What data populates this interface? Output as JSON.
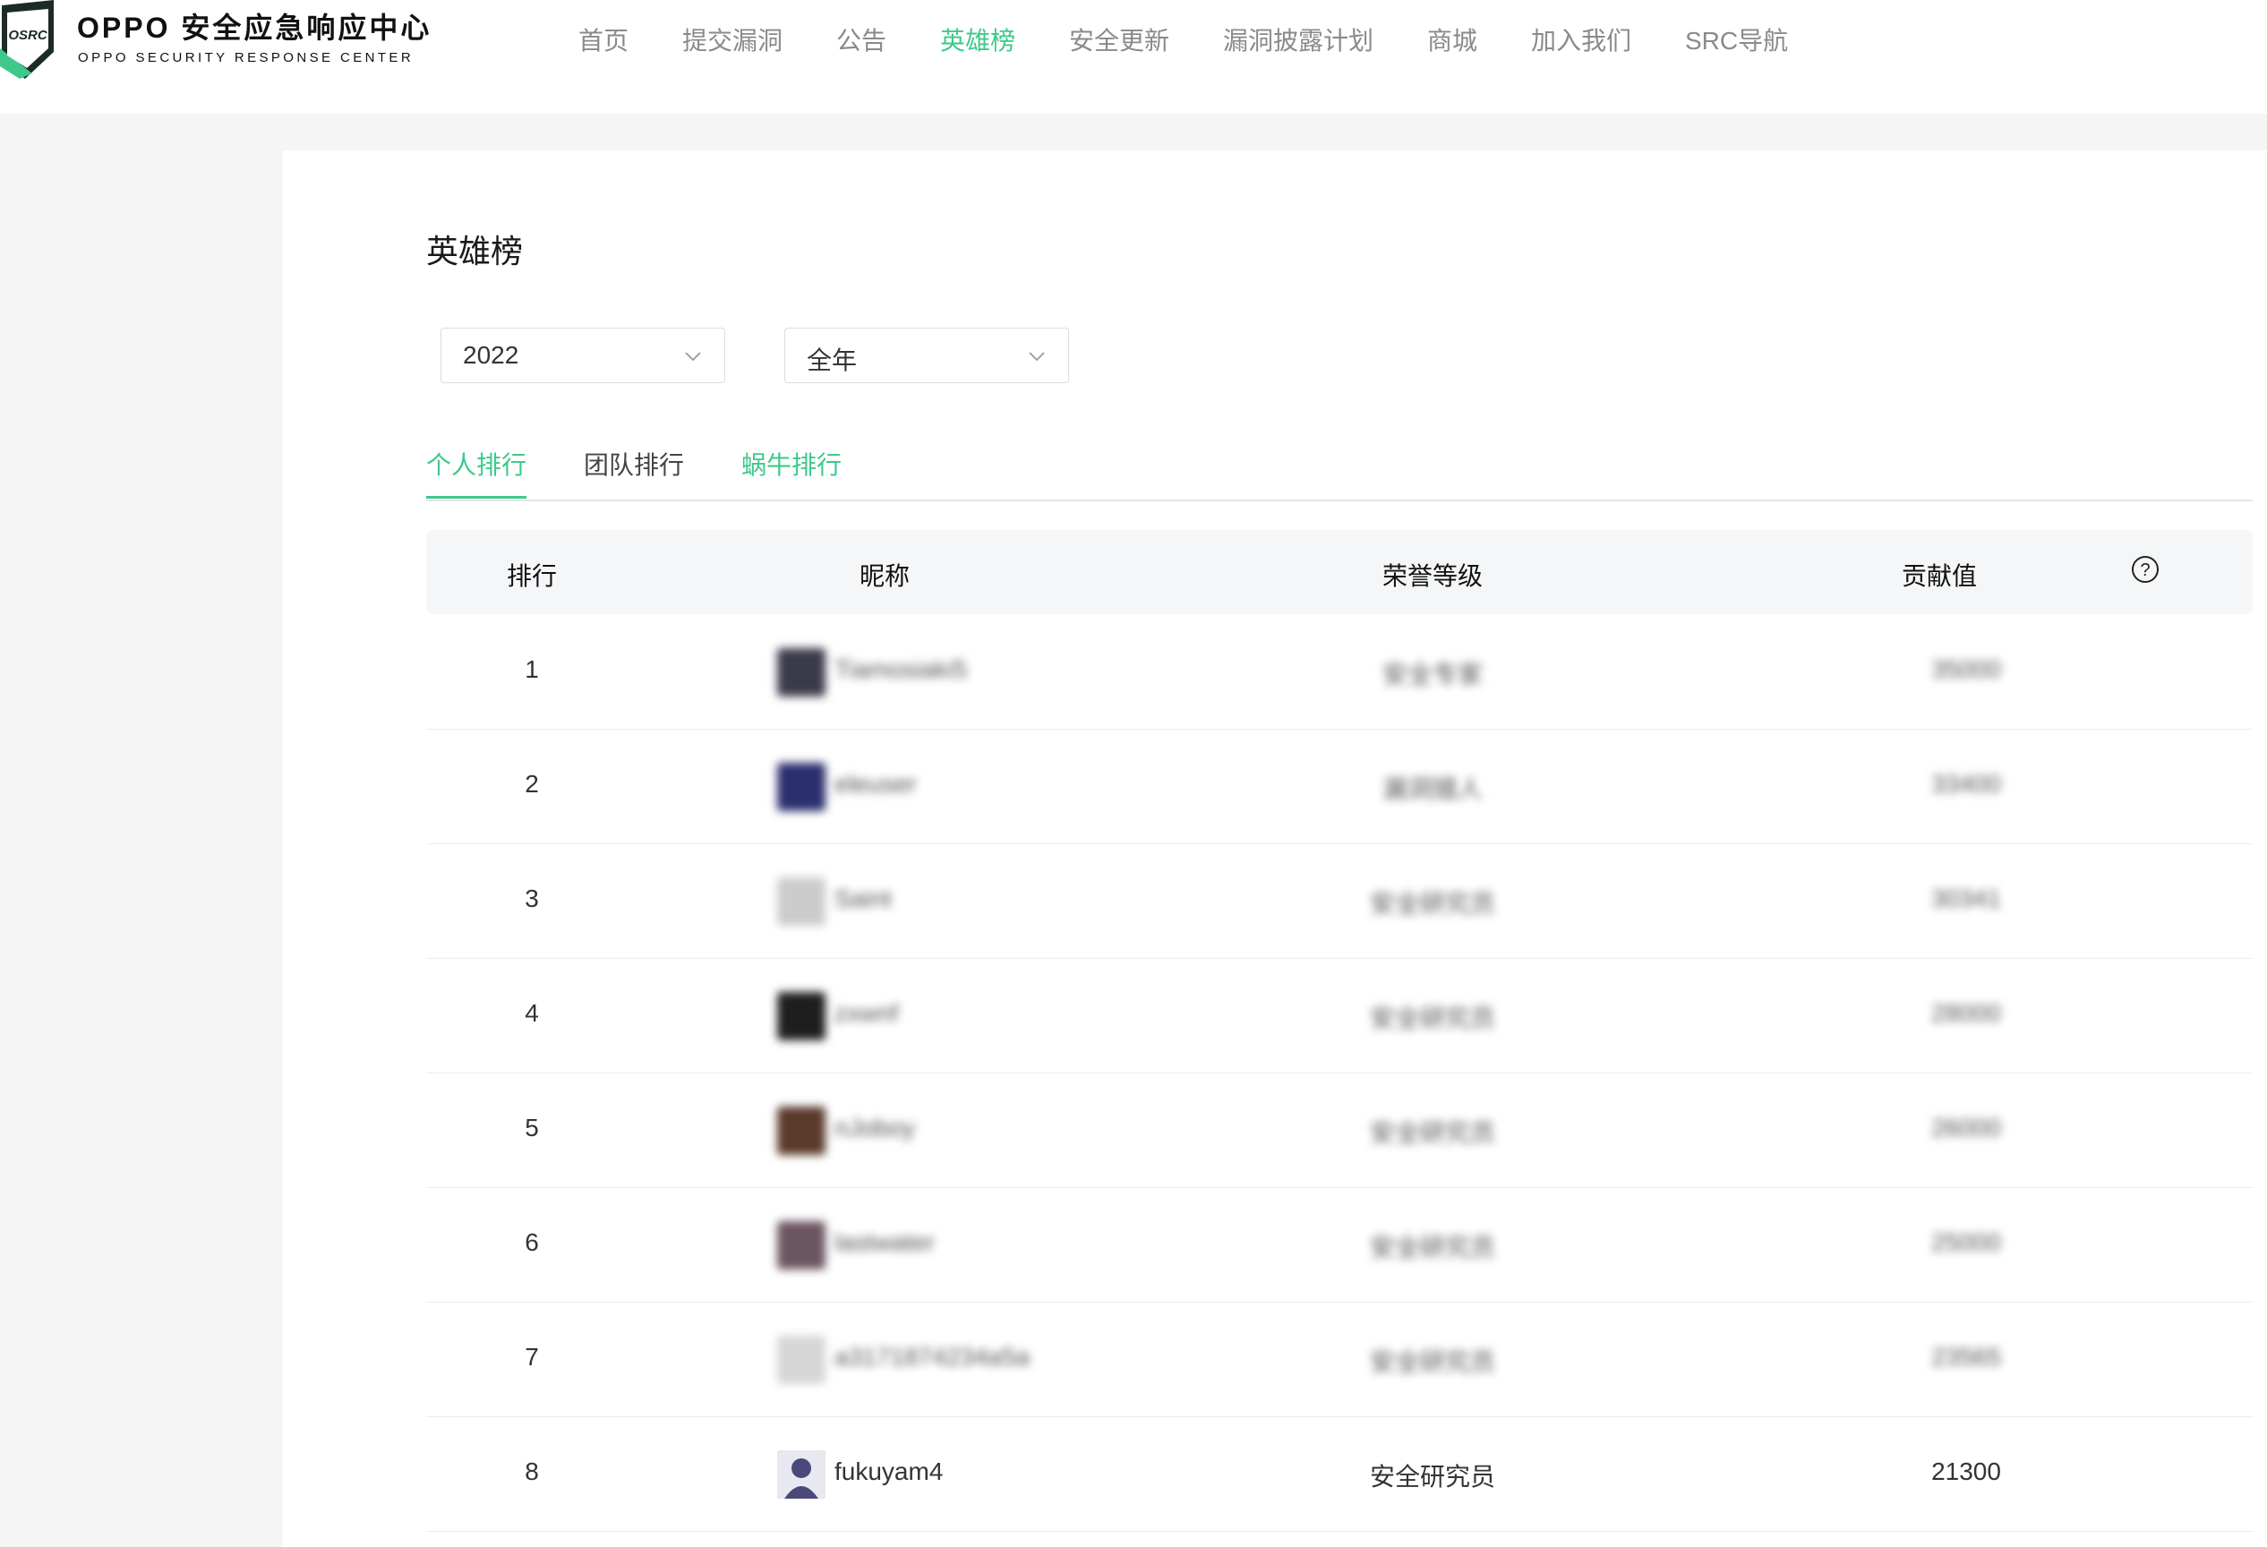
{
  "header": {
    "logo_badge": "OSRC",
    "title": "OPPO 安全应急响应中心",
    "subtitle": "OPPO SECURITY RESPONSE CENTER",
    "nav": [
      {
        "label": "首页",
        "active": false
      },
      {
        "label": "提交漏洞",
        "active": false
      },
      {
        "label": "公告",
        "active": false
      },
      {
        "label": "英雄榜",
        "active": true
      },
      {
        "label": "安全更新",
        "active": false
      },
      {
        "label": "漏洞披露计划",
        "active": false
      },
      {
        "label": "商城",
        "active": false
      },
      {
        "label": "加入我们",
        "active": false
      },
      {
        "label": "SRC导航",
        "active": false
      }
    ]
  },
  "page": {
    "title": "英雄榜",
    "filters": {
      "year": "2022",
      "period": "全年"
    },
    "tabs": [
      {
        "label": "个人排行",
        "active": true
      },
      {
        "label": "团队排行",
        "active": false
      },
      {
        "label": "蜗牛排行",
        "active": false
      }
    ],
    "table": {
      "headers": {
        "rank": "排行",
        "nickname": "昵称",
        "level": "荣誉等级",
        "score": "贡献值",
        "help": "?"
      },
      "rows": [
        {
          "rank": "1",
          "nickname": "Tiamosiaki5",
          "level": "安全专家",
          "score": "35000",
          "avatar_color": "#3a3a4a",
          "blurred": true
        },
        {
          "rank": "2",
          "nickname": "eleuser",
          "level": "漏洞猎人",
          "score": "33400",
          "avatar_color": "#2b2f6e",
          "blurred": true
        },
        {
          "rank": "3",
          "nickname": "Saint",
          "level": "安全研究员",
          "score": "30341",
          "avatar_color": "#cccccc",
          "blurred": true
        },
        {
          "rank": "4",
          "nickname": "zxwnf",
          "level": "安全研究员",
          "score": "28000",
          "avatar_color": "#1e1e1e",
          "blurred": true
        },
        {
          "rank": "5",
          "nickname": "nJoboy",
          "level": "安全研究员",
          "score": "26000",
          "avatar_color": "#5a3a2a",
          "blurred": true
        },
        {
          "rank": "6",
          "nickname": "lastwater",
          "level": "安全研究员",
          "score": "25000",
          "avatar_color": "#6b5560",
          "blurred": true
        },
        {
          "rank": "7",
          "nickname": "a3171874234a5a",
          "level": "安全研究员",
          "score": "23565",
          "avatar_color": "#d6d6d6",
          "blurred": true
        },
        {
          "rank": "8",
          "nickname": "fukuyam4",
          "level": "安全研究员",
          "score": "21300",
          "avatar_color": "#4a4a7a",
          "blurred": false
        }
      ]
    }
  },
  "colors": {
    "accent": "#3ec98a",
    "logo_dark": "#1c2a28"
  }
}
